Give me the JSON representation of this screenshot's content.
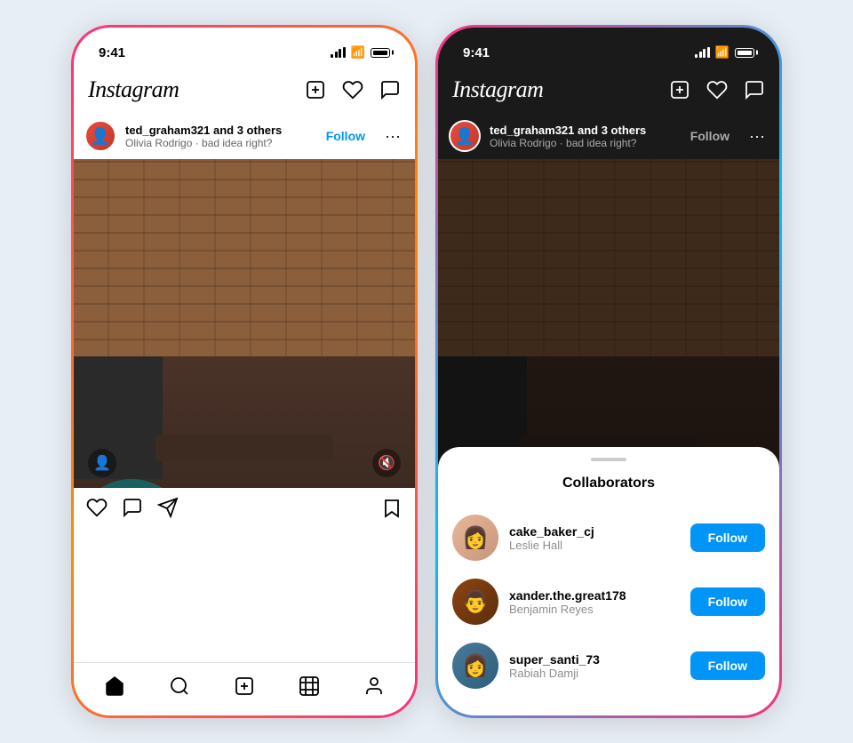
{
  "phones": {
    "left": {
      "time": "9:41",
      "logo": "Instagram",
      "post": {
        "username": "ted_graham321 and 3 others",
        "subtitle": "Olivia Rodrigo · bad idea right?",
        "follow_label": "Follow",
        "actions": {
          "like_label": "like",
          "comment_label": "comment",
          "share_label": "share",
          "save_label": "save"
        }
      },
      "tabs": [
        "home",
        "search",
        "add",
        "reels",
        "profile"
      ]
    },
    "right": {
      "time": "9:41",
      "logo": "Instagram",
      "post": {
        "username": "ted_graham321 and 3 others",
        "subtitle": "Olivia Rodrigo · bad idea right?",
        "follow_label": "Follow"
      },
      "collaborators": {
        "title": "Collaborators",
        "items": [
          {
            "username": "cake_baker_cj",
            "name": "Leslie Hall",
            "follow_label": "Follow"
          },
          {
            "username": "xander.the.great178",
            "name": "Benjamin Reyes",
            "follow_label": "Follow"
          },
          {
            "username": "super_santi_73",
            "name": "Rabiah Damji",
            "follow_label": "Follow"
          }
        ]
      }
    }
  }
}
